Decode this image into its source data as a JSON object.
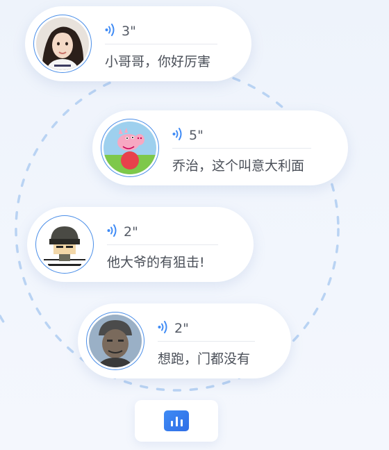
{
  "messages": [
    {
      "duration": "3\"",
      "text": "小哥哥，你好厉害",
      "avatar": "girl-avatar"
    },
    {
      "duration": "5\"",
      "text": "乔治，这个叫意大利面",
      "avatar": "peppa-pig-avatar"
    },
    {
      "duration": "2\"",
      "text": "他大爷的有狙击!",
      "avatar": "helmet-meme-avatar"
    },
    {
      "duration": "2\"",
      "text": "想跑，门都没有",
      "avatar": "old-man-avatar"
    }
  ],
  "colors": {
    "accent": "#3f8bf5",
    "ring": "#b9d3f3",
    "bubble_bg": "#ffffff",
    "text": "#4a4f58"
  },
  "icons": {
    "voice": "sound-wave-icon",
    "record": "audio-bars-icon"
  }
}
